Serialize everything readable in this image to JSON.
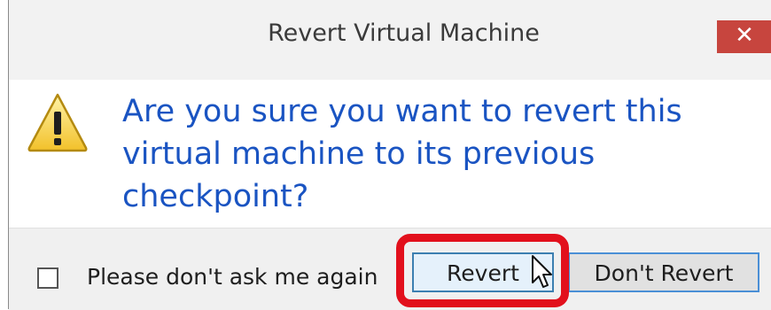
{
  "window": {
    "title": "Revert Virtual Machine",
    "close_glyph": "✕"
  },
  "content": {
    "icon": "warning-icon",
    "message": "Are you sure you want to revert this virtual machine to its previous checkpoint?"
  },
  "footer": {
    "checkbox_label": "Please don't ask me again",
    "checkbox_checked": false,
    "revert_label": "Revert",
    "dont_revert_label": "Don't Revert"
  },
  "colors": {
    "message_text": "#1a54c2",
    "close_button": "#c7453e",
    "highlight_box": "#e2101c"
  }
}
